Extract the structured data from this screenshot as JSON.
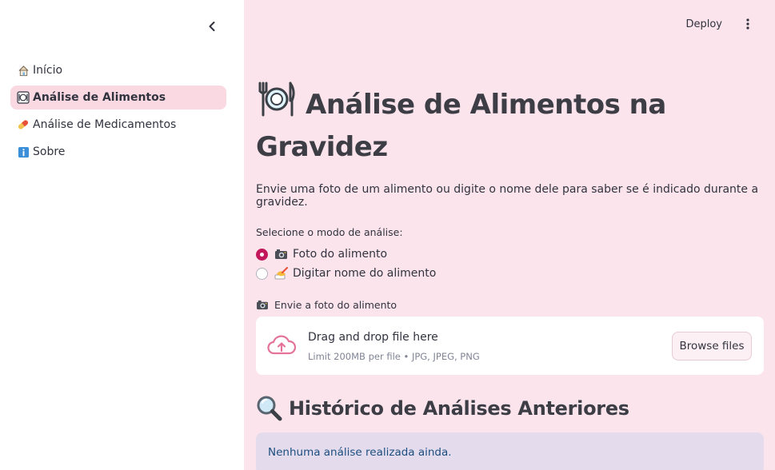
{
  "sidebar": {
    "items": [
      {
        "label": "Início",
        "icon": "house-icon",
        "active": false
      },
      {
        "label": "Análise de Alimentos",
        "icon": "plate-icon",
        "active": true
      },
      {
        "label": "Análise de Medicamentos",
        "icon": "pill-icon",
        "active": false
      },
      {
        "label": "Sobre",
        "icon": "info-icon",
        "active": false
      }
    ]
  },
  "topbar": {
    "deploy_label": "Deploy"
  },
  "main": {
    "title": "Análise de Alimentos na Gravidez",
    "subtitle": "Envie uma foto de um alimento ou digite o nome dele para saber se é indicado durante a gravidez.",
    "radio_label": "Selecione o modo de análise:",
    "radio_options": [
      {
        "label": "Foto do alimento",
        "icon": "camera-icon",
        "selected": true
      },
      {
        "label": "Digitar nome do alimento",
        "icon": "writing-hand-icon",
        "selected": false
      }
    ],
    "upload": {
      "label": "Envie a foto do alimento",
      "drag_text": "Drag and drop file here",
      "limit_text": "Limit 200MB per file • JPG, JPEG, PNG",
      "browse_label": "Browse files"
    },
    "history": {
      "title": "Histórico de Análises Anteriores",
      "empty_text": "Nenhuma análise realizada ainda."
    }
  },
  "colors": {
    "accent": "#c2185b",
    "background": "#fce4ec",
    "info_bg": "#e4dced",
    "info_text": "#1c4e80"
  }
}
